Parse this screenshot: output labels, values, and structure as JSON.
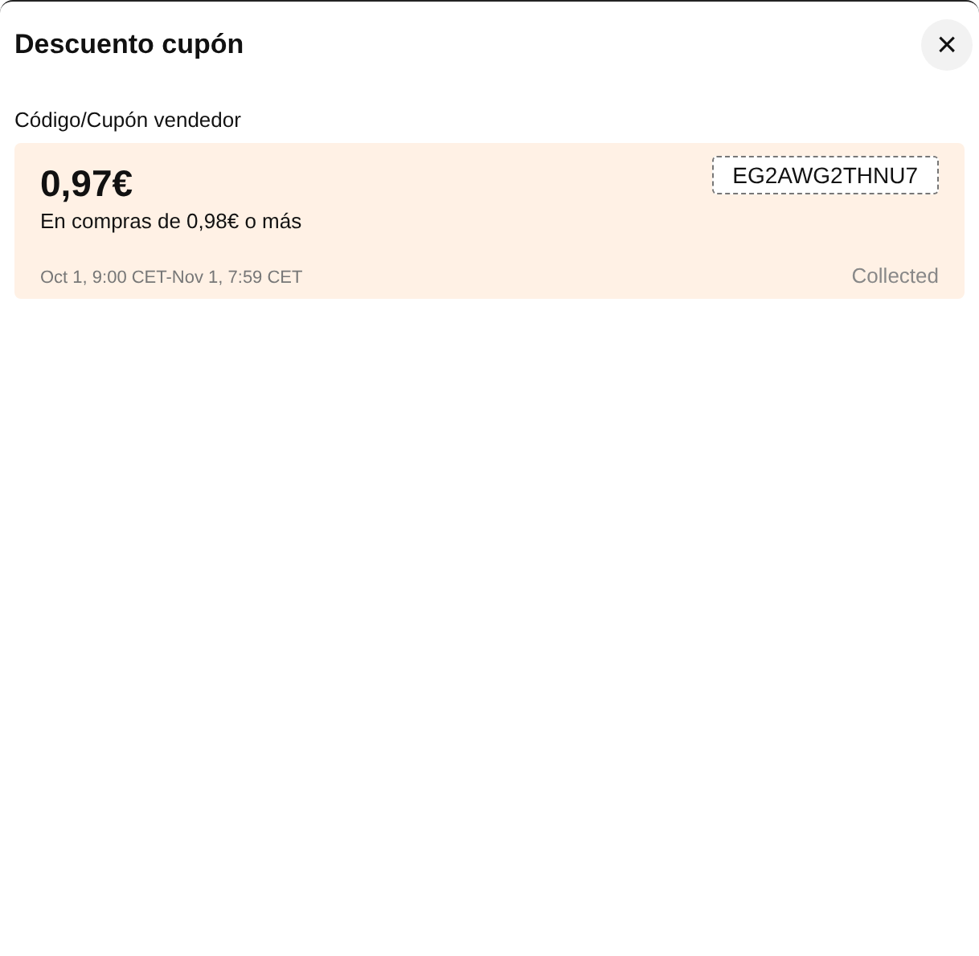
{
  "dialog": {
    "title": "Descuento cupón",
    "close_label": "×"
  },
  "section_label": "Código/Cupón vendedor",
  "coupons": [
    {
      "amount": "0,97€",
      "condition": "En compras de 0,98€ o más",
      "code": "EG2AWG2THNU7",
      "validity": "Oct 1, 9:00 CET-Nov 1, 7:59 CET",
      "status": "Collected"
    }
  ]
}
